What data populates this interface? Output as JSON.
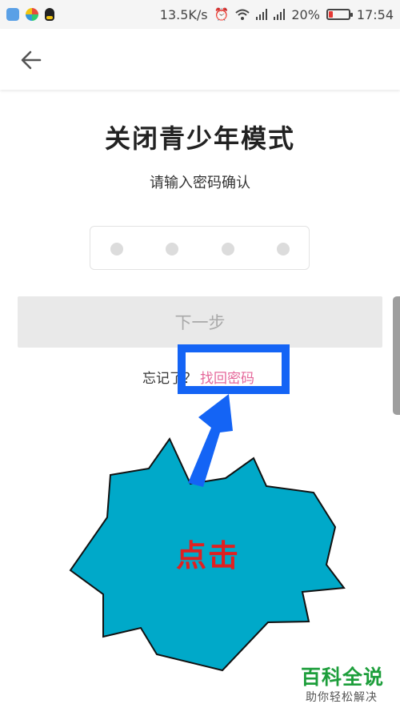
{
  "status_bar": {
    "network_speed": "13.5K/s",
    "battery_percent": "20%",
    "battery_level": 0.2,
    "time": "17:54",
    "icons": [
      "shield-app-icon",
      "browser-app-icon",
      "qq-penguin-icon",
      "alarm-icon",
      "wifi-icon",
      "signal-icon",
      "signal-icon",
      "battery-icon"
    ]
  },
  "header": {
    "back_icon": "arrow-left-icon"
  },
  "page": {
    "title": "关闭青少年模式",
    "subtitle": "请输入密码确认",
    "pin_length": 4,
    "next_button": "下一步",
    "forgot_text": "忘记了？",
    "recover_link": "找回密码"
  },
  "annotation": {
    "callout_text": "点击",
    "colors": {
      "highlight": "#1464f5",
      "starburst": "#00a9c9",
      "callout_text": "#e02020"
    }
  },
  "watermark": {
    "title": "百科全说",
    "subtitle": "助你轻松解决"
  },
  "colors": {
    "link": "#e5679a",
    "button_disabled": "#e9e9e9"
  }
}
